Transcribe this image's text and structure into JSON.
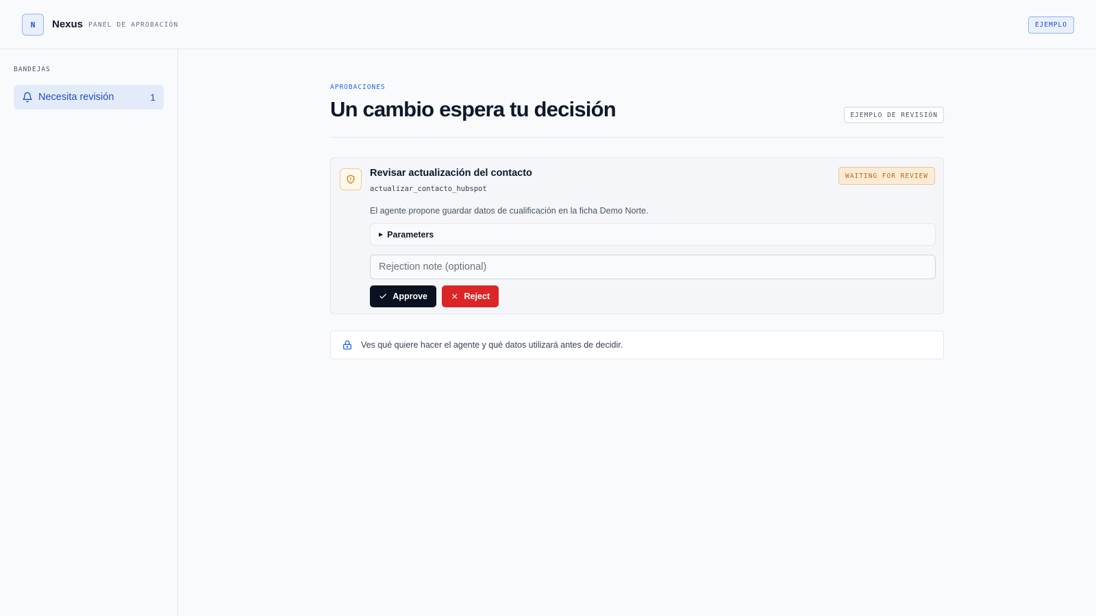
{
  "header": {
    "logo_letter": "N",
    "brand": "Nexus",
    "subtitle": "PANEL DE APROBACIÓN",
    "env_badge": "EJEMPLO"
  },
  "sidebar": {
    "heading": "BANDEJAS",
    "items": [
      {
        "icon": "bell-icon",
        "label": "Necesita revisión",
        "count": "1"
      }
    ]
  },
  "main": {
    "eyebrow": "APROBACIONES",
    "title": "Un cambio espera tu decisión",
    "demo_tag": "EJEMPLO DE REVISIÓN",
    "card": {
      "icon": "shield-alert-icon",
      "title": "Revisar actualización del contacto",
      "tool_name": "actualizar_contacto_hubspot",
      "status": "WAITING FOR REVIEW",
      "description": "El agente propone guardar datos de cualificación en la ficha Demo Norte.",
      "parameters_label": "Parameters",
      "rejection_placeholder": "Rejection note (optional)",
      "rejection_value": "",
      "approve_label": "Approve",
      "reject_label": "Reject"
    },
    "info": {
      "icon": "lock-icon",
      "text": "Ves qué quiere hacer el agente y qué datos utilizará antes de decidir."
    }
  },
  "colors": {
    "accent": "#1d4ed8",
    "approve": "#0b1120",
    "reject": "#dc2626",
    "warning": "#c2650a"
  }
}
